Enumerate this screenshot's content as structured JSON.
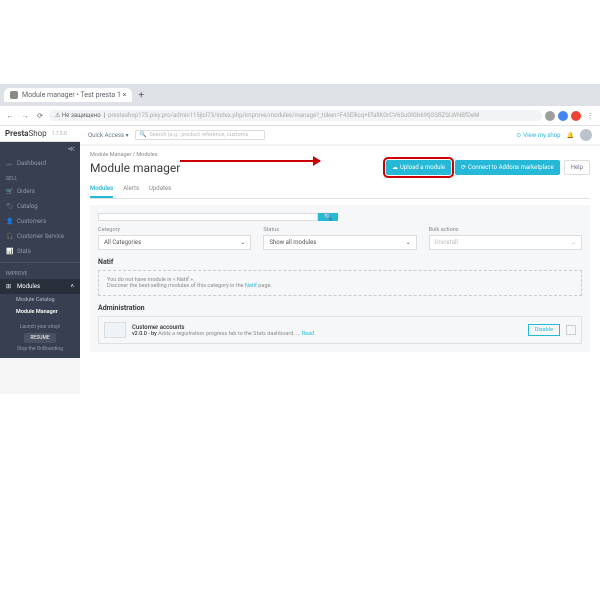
{
  "browser": {
    "tab_title": "Module manager • Test presta 1   ×",
    "address_warning": "⚠ Не защищено",
    "url": "prestashop175.pixy.pro/admin115jicl73/index.php/improve/modules/manage?_token=F43Elkcq+EfalIKGrCV6SuGlGb69tjGSRZSLWNBfDeM"
  },
  "logo": {
    "brand": "PrestaShop",
    "version": "1.7.5.0"
  },
  "topbar": {
    "quick_access": "Quick Access ▾",
    "search_placeholder": "Search (e.g.: product reference, customs",
    "view_shop": "View my shop"
  },
  "sidebar": {
    "dashboard": "Dashboard",
    "section_sell": "SELL",
    "orders": "Orders",
    "catalog": "Catalog",
    "customers": "Customers",
    "customer_service": "Customer Service",
    "stats": "Stats",
    "section_improve": "IMPROVE",
    "modules": "Modules",
    "module_catalog": "Module Catalog",
    "module_manager": "Module Manager",
    "launch": "Launch your shop!",
    "resume": "RESUME",
    "stop": "Stop the OnBoarding"
  },
  "page": {
    "breadcrumb": "Module Manager  /  Modules",
    "title": "Module manager",
    "upload_btn": "Upload a module",
    "addons_btn": "Connect to Addons marketplace",
    "help_btn": "Help"
  },
  "tabs": {
    "modules": "Modules",
    "alerts": "Alerts",
    "updates": "Updates"
  },
  "filters": {
    "category_label": "Category",
    "category_value": "All Categories",
    "status_label": "Status",
    "status_value": "Show all modules",
    "bulk_label": "Bulk actions",
    "bulk_value": "Uninstall"
  },
  "natif": {
    "title": "Natif",
    "line1": "You do not have module in « Natif ».",
    "line2a": "Discover the best-selling modules of this category in the ",
    "link": "Natif",
    "line2b": " page."
  },
  "admin": {
    "title": "Administration",
    "mod_name": "Customer accounts",
    "mod_version": "v2.0.0 - by",
    "mod_desc": "Adds a registration progress tab to the Stats dashboard. ... ",
    "mod_read": "Read",
    "disable": "Disable"
  }
}
